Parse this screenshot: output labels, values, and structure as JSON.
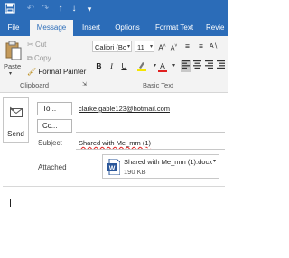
{
  "quick_access": {
    "save_icon": "save-icon",
    "undo_icon": "undo-icon",
    "redo_icon": "redo-icon",
    "up_icon": "arrow-up-icon",
    "down_icon": "arrow-down-icon",
    "more_icon": "customize-icon"
  },
  "tabs": {
    "file": "File",
    "message": "Message",
    "insert": "Insert",
    "options": "Options",
    "format_text": "Format Text",
    "review": "Revie"
  },
  "clipboard": {
    "paste": "Paste",
    "cut": "Cut",
    "copy": "Copy",
    "format_painter": "Format Painter",
    "group": "Clipboard"
  },
  "basic_text": {
    "font": "Calibri (Bo",
    "size": "11",
    "group": "Basic Text",
    "bold": "B",
    "italic": "I",
    "underline": "U",
    "font_color": "A"
  },
  "compose": {
    "send": "Send",
    "to_button": "To...",
    "cc_button": "Cc...",
    "to_value": "clarke.gable123@hotmail.com",
    "cc_value": "",
    "subject_label": "Subject",
    "subject_value": "Shared with Me_mm (1)",
    "attached_label": "Attached",
    "attachment_name": "Shared with Me_mm (1).docx",
    "attachment_size": "190 KB"
  },
  "colors": {
    "accent": "#2b6cb8",
    "ribbon": "#f3f3f3",
    "word_icon": "#2b579a"
  }
}
